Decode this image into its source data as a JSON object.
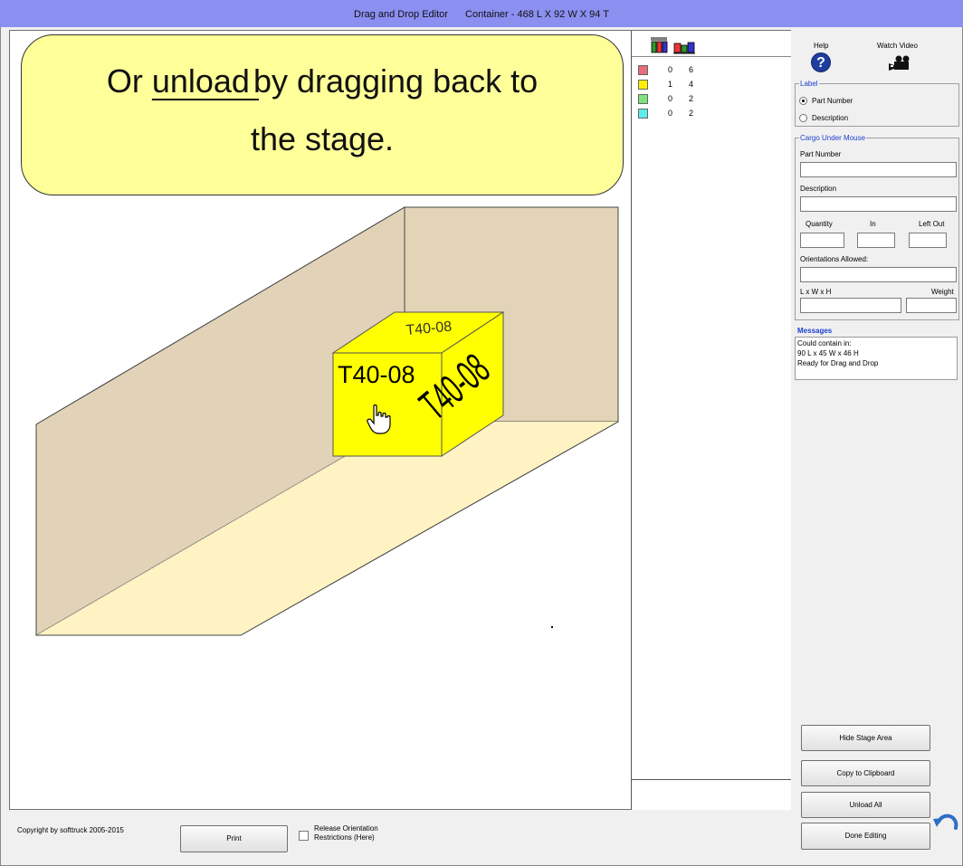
{
  "window": {
    "title": "Drag and Drop Editor",
    "container_info": "Container - 468 L X 92 W X 94 T"
  },
  "callout": {
    "prefix": "Or ",
    "underlined": "unload ",
    "suffix": "by dragging back to",
    "line2": "the stage."
  },
  "cargo_box": {
    "label": "T40-08"
  },
  "cargo_list": {
    "rows": [
      {
        "color": "#e86c7a",
        "in": "0",
        "left": "6"
      },
      {
        "color": "#ffef00",
        "in": "1",
        "left": "4"
      },
      {
        "color": "#7ee27e",
        "in": "0",
        "left": "2"
      },
      {
        "color": "#5cecec",
        "in": "0",
        "left": "2"
      }
    ]
  },
  "side": {
    "help_label": "Help",
    "help_glyph": "?",
    "video_label": "Watch Video",
    "label_group": {
      "title": "Label",
      "options": [
        "Part Number",
        "Description"
      ],
      "selected": "Part Number"
    },
    "cargo_group": {
      "title": "Cargo Under Mouse",
      "part_number_label": "Part Number",
      "part_number_value": "",
      "description_label": "Description",
      "description_value": "",
      "quantity_label": "Quantity",
      "in_label": "In",
      "left_out_label": "Left Out",
      "orientations_label": "Orientations Allowed:",
      "lwh_label": "L x W x H",
      "weight_label": "Weight"
    },
    "messages": {
      "title": "Messages",
      "lines": [
        "Could contain in:",
        "90 L x 45 W x 46 H",
        "Ready for Drag and Drop"
      ]
    },
    "buttons": {
      "hide_stage": "Hide Stage Area",
      "copy": "Copy to Clipboard",
      "unload_all": "Unload All",
      "done": "Done Editing"
    }
  },
  "footer": {
    "copyright": "Copyright by softtruck 2005-2015",
    "print": "Print",
    "release_line1": "Release Orientation",
    "release_line2": "Restrictions (Here)",
    "release_checked": false
  },
  "colors": {
    "titlebar": "#8b8ff0",
    "callout_fill": "#ffff99",
    "container_wall": "#e2d3b8",
    "container_floor": "#fff3c4",
    "cargo_yellow": "#ffff00",
    "accent_blue": "#1a3fd0"
  },
  "icons": {
    "help": "help-question-icon",
    "video": "movie-camera-icon",
    "cursor": "hand-pointer-icon",
    "undo": "undo-arrow-icon",
    "list_header": [
      "stacked-cargo-icon",
      "unloaded-cargo-icon"
    ]
  }
}
